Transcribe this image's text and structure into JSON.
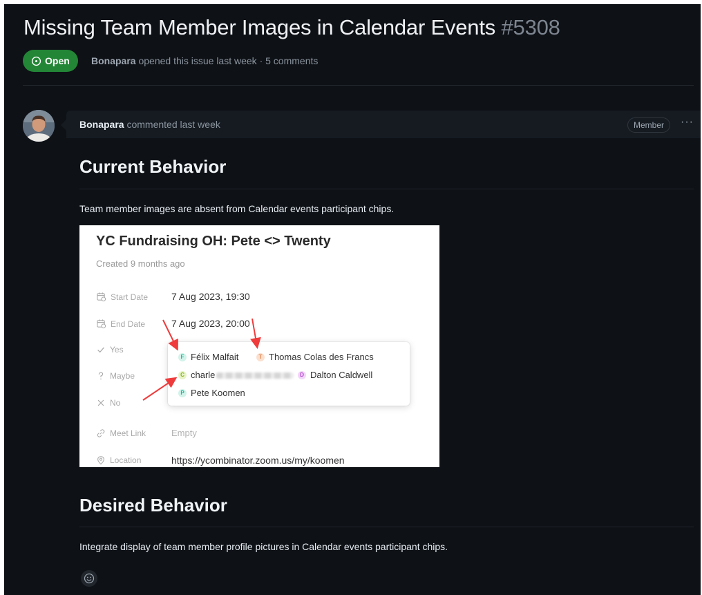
{
  "issue": {
    "title": "Missing Team Member Images in Calendar Events",
    "number": "#5308",
    "state": "Open",
    "author": "Bonapara",
    "summary": "opened this issue last week · 5 comments"
  },
  "comment": {
    "author": "Bonapara",
    "action": "commented last week",
    "role": "Member",
    "more": "···",
    "sections": {
      "current_heading": "Current Behavior",
      "current_text": "Team member images are absent from Calendar events participant chips.",
      "desired_heading": "Desired Behavior",
      "desired_text": "Integrate display of team member profile pictures in Calendar events participant chips."
    }
  },
  "embedded_screenshot": {
    "title": "YC Fundraising OH: Pete <> Twenty",
    "created": "Created 9 months ago",
    "properties": [
      {
        "label": "Start Date",
        "value": "7 Aug 2023, 19:30",
        "icon": "calendar-clock-icon"
      },
      {
        "label": "End Date",
        "value": "7 Aug 2023, 20:00",
        "icon": "calendar-clock-icon"
      },
      {
        "label": "Yes",
        "value": "",
        "icon": "check-icon"
      },
      {
        "label": "Maybe",
        "value": "",
        "icon": "question-icon"
      },
      {
        "label": "No",
        "value": "",
        "icon": "x-icon"
      },
      {
        "label": "Meet Link",
        "value": "Empty",
        "icon": "link-icon"
      },
      {
        "label": "Location",
        "value": "https://ycombinator.zoom.us/my/koomen",
        "icon": "location-pin-icon"
      }
    ],
    "participants": [
      {
        "initial": "F",
        "name": "Félix Malfait",
        "color": "#1fb89a",
        "bg": "#d2f3ea"
      },
      {
        "initial": "T",
        "name": "Thomas Colas des Francs",
        "color": "#e0824a",
        "bg": "#fbe0cf"
      },
      {
        "initial": "C",
        "name": "charle",
        "color": "#88b51c",
        "bg": "#e7f3c8"
      },
      {
        "initial": "D",
        "name": "Dalton Caldwell",
        "color": "#b03fd0",
        "bg": "#f1d6f8"
      },
      {
        "initial": "P",
        "name": "Pete Koomen",
        "color": "#1fb89a",
        "bg": "#d2f3ea"
      }
    ],
    "annotation_color": "#ef3b3b"
  },
  "colors": {
    "page_bg": "#0e1116",
    "header_bg": "#161b22",
    "open_green": "#238636"
  }
}
